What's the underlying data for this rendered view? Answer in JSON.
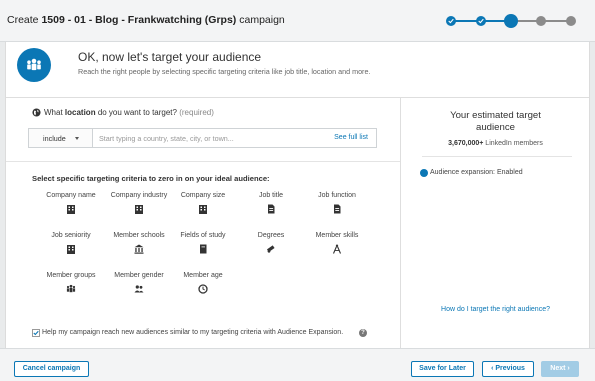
{
  "header": {
    "title_prefix": "Create",
    "title_bold": "1509 - 01 - Blog - Frankwatching (Grps)",
    "title_suffix": "campaign",
    "steps": [
      "done",
      "done",
      "current",
      "todo",
      "todo"
    ],
    "colors": {
      "accent": "#0b77b5",
      "pending": "#8b8b8b"
    }
  },
  "intro": {
    "icon": "audience-icon",
    "title": "OK, now let's target your audience",
    "subtitle": "Reach the right people by selecting specific targeting criteria like job title, location and more."
  },
  "location": {
    "q_prefix": "What",
    "q_bold": "location",
    "q_suffix": "do you want to target?",
    "q_required": "(required)",
    "include_value": "include",
    "placeholder": "Start typing a country, state, city, or town...",
    "see_full_list": "See full list"
  },
  "criteria": {
    "title": "Select specific targeting criteria to zero in on your ideal audience:",
    "items": [
      {
        "label": "Company name",
        "icon": "building-icon"
      },
      {
        "label": "Company industry",
        "icon": "building-icon"
      },
      {
        "label": "Company size",
        "icon": "building-icon"
      },
      {
        "label": "Job title",
        "icon": "document-icon"
      },
      {
        "label": "Job function",
        "icon": "document-icon"
      },
      {
        "label": "Job seniority",
        "icon": "building-icon"
      },
      {
        "label": "Member schools",
        "icon": "school-icon"
      },
      {
        "label": "Fields of study",
        "icon": "book-icon"
      },
      {
        "label": "Degrees",
        "icon": "diploma-icon"
      },
      {
        "label": "Member skills",
        "icon": "compass-icon"
      },
      {
        "label": "Member groups",
        "icon": "group-icon"
      },
      {
        "label": "Member gender",
        "icon": "people-icon"
      },
      {
        "label": "Member age",
        "icon": "clock-icon"
      }
    ]
  },
  "expansion": {
    "checked": true,
    "label": "Help my campaign reach new audiences similar to my targeting criteria with Audience Expansion.",
    "help_icon": "question-icon",
    "help_glyph": "?"
  },
  "estimate": {
    "title_line1": "Your estimated target",
    "title_line2": "audience",
    "count": "3,670,000+",
    "count_suffix": "LinkedIn members",
    "expansion_status": "Audience expansion: Enabled",
    "link": "How do I target the right audience?"
  },
  "footer": {
    "cancel": "Cancel campaign",
    "save": "Save for Later",
    "previous": "‹ Previous",
    "next": "Next ›"
  }
}
